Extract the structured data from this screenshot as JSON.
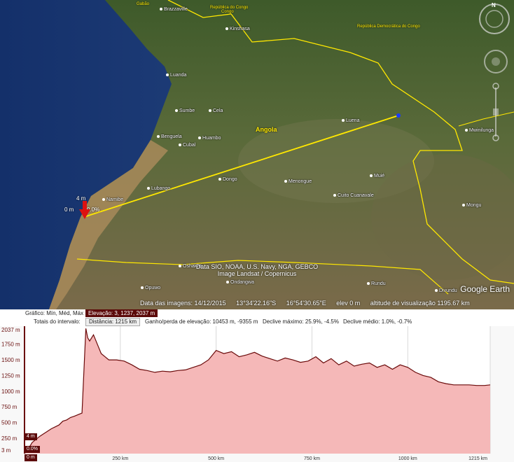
{
  "map": {
    "countries": [
      {
        "name": "Gabão"
      },
      {
        "name": "República do Congo"
      },
      {
        "name": "Congo"
      },
      {
        "name": "República Democrática do Congo"
      },
      {
        "name": "Angola"
      }
    ],
    "places": [
      {
        "name": "Brazzaville"
      },
      {
        "name": "Kinshasa"
      },
      {
        "name": "Luanda"
      },
      {
        "name": "Sumbe"
      },
      {
        "name": "Cela"
      },
      {
        "name": "Benguela"
      },
      {
        "name": "Cubal"
      },
      {
        "name": "Huambo"
      },
      {
        "name": "Luena"
      },
      {
        "name": "Mwinilunga"
      },
      {
        "name": "Lubango"
      },
      {
        "name": "Dongo"
      },
      {
        "name": "Menongue"
      },
      {
        "name": "Muié"
      },
      {
        "name": "Cuito Cuanavale"
      },
      {
        "name": "Namibe"
      },
      {
        "name": "Mongu"
      },
      {
        "name": "Oshakati"
      },
      {
        "name": "Ondangwa"
      },
      {
        "name": "Opuwo"
      },
      {
        "name": "Rundu"
      },
      {
        "name": "Divundu"
      }
    ],
    "pin": {
      "elev_label": "4 m",
      "base_label": "0 m",
      "pct_label": "0.0%"
    },
    "credits": {
      "line1": "Data SIO, NOAA, U.S. Navy, NGA, GEBCO",
      "line2": "Image Landsat / Copernicus"
    },
    "brand": "Google Earth",
    "status": {
      "imagery_date": "Data das imagens: 14/12/2015",
      "lat": "13°34'22.16\"S",
      "lon": "16°54'30.65\"E",
      "elev": "elev    0 m",
      "eye_alt": "altitude de visualização 1195.67 km"
    },
    "compass_letter": "N"
  },
  "profile": {
    "header1": {
      "label": "Gráfico: Mín, Méd, Máx",
      "value": "Elevação: 3, 1237, 2037 m"
    },
    "header2": {
      "label": "Totais do intervalo:",
      "distance": "Distância: 1215 km",
      "gain": "Ganho/perda de elevação: 10453 m, -9355 m",
      "max_slope": "Declive máximo: 25.9%, -4.5%",
      "avg_slope": "Declive médio: 1.0%, -0.7%"
    },
    "marker_elev": "4 m",
    "marker_pct": "0.0%",
    "marker_dist": "0 m"
  },
  "chart_data": {
    "type": "area",
    "title": "",
    "xlabel": "",
    "ylabel": "",
    "x_tick_labels": [
      "250 km",
      "500 km",
      "750 km",
      "1000 km",
      "1215 km"
    ],
    "x_ticks": [
      250,
      500,
      750,
      1000,
      1215
    ],
    "y_tick_labels": [
      "2037 m",
      "1750 m",
      "1500 m",
      "1250 m",
      "1000 m",
      "750 m",
      "500 m",
      "250 m",
      "3 m"
    ],
    "y_ticks": [
      2037,
      1750,
      1500,
      1250,
      1000,
      750,
      500,
      250,
      3
    ],
    "xlim": [
      0,
      1215
    ],
    "ylim": [
      3,
      2037
    ],
    "grid": true,
    "fill_color": "#f5b8b8",
    "line_color": "#6a0a0a",
    "series": [
      {
        "x": [
          0,
          10,
          20,
          30,
          40,
          50,
          60,
          70,
          80,
          90,
          100,
          110,
          120,
          130,
          150,
          160,
          165,
          170,
          180,
          190,
          200,
          210,
          220,
          240,
          260,
          280,
          300,
          320,
          340,
          360,
          380,
          400,
          420,
          440,
          460,
          480,
          500,
          520,
          540,
          560,
          580,
          600,
          620,
          640,
          660,
          680,
          700,
          720,
          740,
          760,
          780,
          800,
          820,
          840,
          860,
          880,
          900,
          920,
          940,
          960,
          980,
          1000,
          1020,
          1040,
          1060,
          1080,
          1100,
          1120,
          1140,
          1160,
          1180,
          1200,
          1215
        ],
        "y": [
          3,
          80,
          180,
          230,
          280,
          320,
          360,
          400,
          430,
          460,
          520,
          540,
          580,
          600,
          650,
          2000,
          1850,
          1800,
          1900,
          1750,
          1600,
          1550,
          1500,
          1500,
          1480,
          1420,
          1350,
          1330,
          1300,
          1320,
          1310,
          1330,
          1340,
          1380,
          1420,
          1500,
          1650,
          1600,
          1630,
          1550,
          1580,
          1620,
          1560,
          1520,
          1480,
          1530,
          1500,
          1460,
          1480,
          1550,
          1450,
          1520,
          1420,
          1480,
          1400,
          1430,
          1450,
          1380,
          1420,
          1350,
          1420,
          1380,
          1300,
          1250,
          1220,
          1150,
          1120,
          1100,
          1100,
          1100,
          1090,
          1090,
          1100
        ]
      }
    ]
  }
}
